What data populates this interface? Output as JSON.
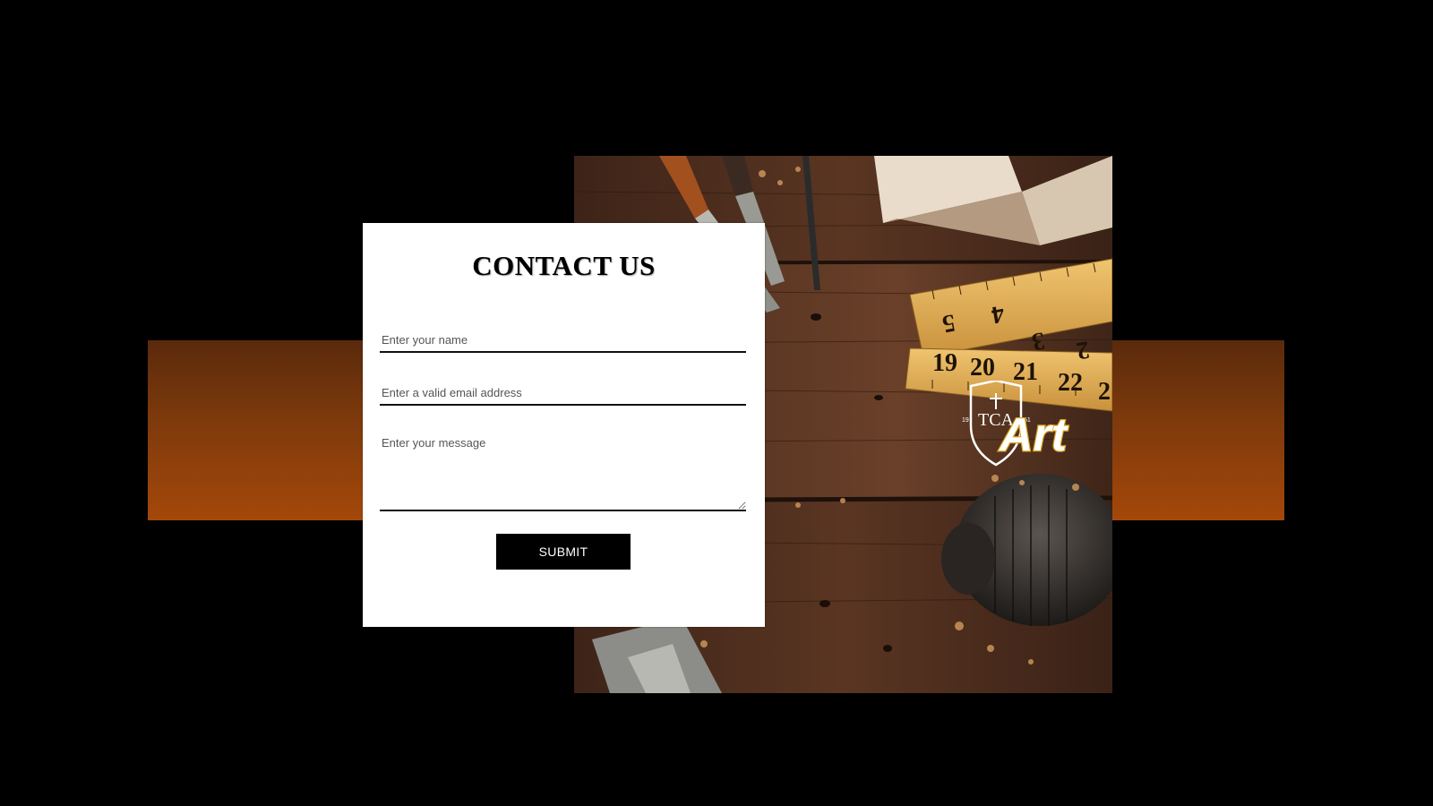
{
  "contact": {
    "title": "CONTACT US",
    "name_placeholder": "Enter your name",
    "email_placeholder": "Enter a valid email address",
    "message_placeholder": "Enter your message",
    "submit_label": "SUBMIT"
  },
  "logo": {
    "monogram": "TCA",
    "year_left": "19",
    "year_right": "51",
    "wordmark": "Art"
  },
  "ruler": {
    "top_numbers": [
      "5",
      "4",
      "3",
      "2"
    ],
    "bottom_numbers": [
      "19",
      "20",
      "21",
      "22",
      "2"
    ]
  },
  "colors": {
    "background": "#000000",
    "band_top": "#5a2a0c",
    "band_bottom": "#a4480a",
    "button": "#000000",
    "wood": "#4a2c1e",
    "ruler": "#e0b35a",
    "logo_gold": "#d9a21f"
  }
}
